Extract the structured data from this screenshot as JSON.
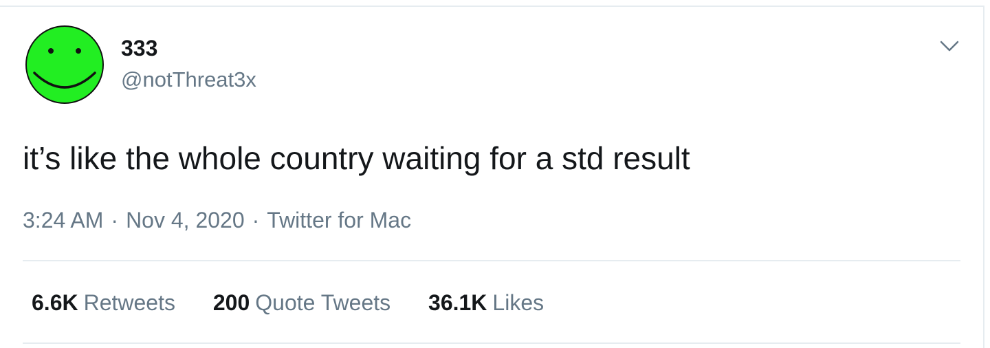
{
  "author": {
    "display_name": "333",
    "handle": "@notThreat3x",
    "avatar_icon": "smiley-face-icon",
    "avatar_color": "#22ee22"
  },
  "tweet": {
    "text": "it’s like the whole country waiting for a std result"
  },
  "meta": {
    "time": "3:24 AM",
    "separator": "·",
    "date": "Nov 4, 2020",
    "source": "Twitter for Mac"
  },
  "stats": {
    "retweets": {
      "count": "6.6K",
      "label": "Retweets"
    },
    "quote_tweets": {
      "count": "200",
      "label": "Quote Tweets"
    },
    "likes": {
      "count": "36.1K",
      "label": "Likes"
    }
  },
  "menu_icon": "chevron-down-icon",
  "colors": {
    "primary_text": "#14171a",
    "secondary_text": "#657786",
    "divider": "#e6ecf0",
    "background": "#ffffff"
  }
}
